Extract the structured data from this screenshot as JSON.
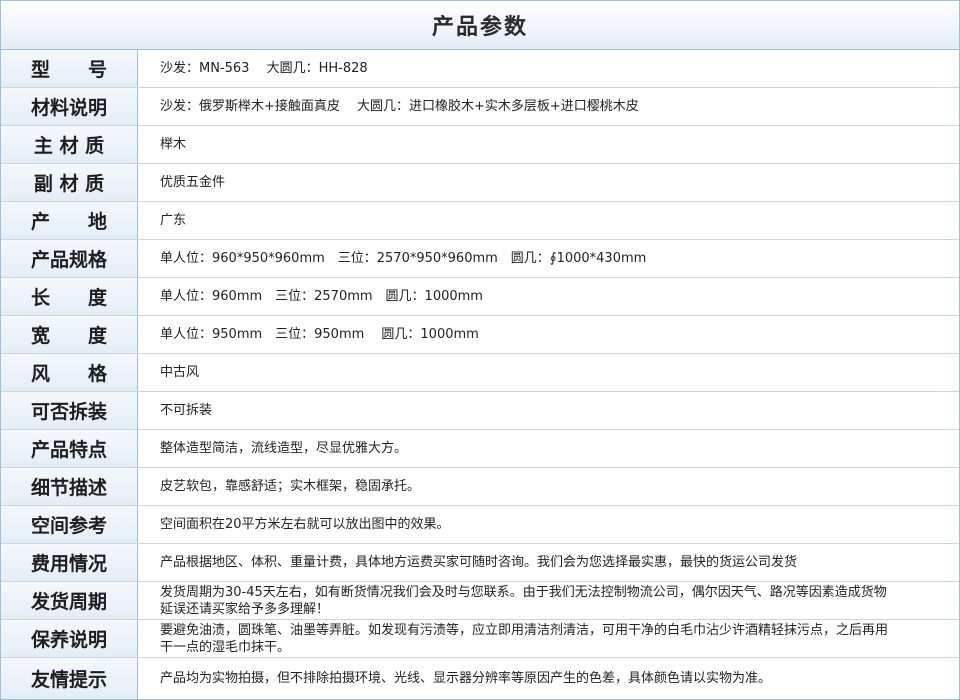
{
  "title": "产品参数",
  "rows": [
    {
      "label": "型　　号",
      "value": "沙发：MN-563　 大圆几：HH-828"
    },
    {
      "label": "材料说明",
      "value": "沙发：俄罗斯榉木+接触面真皮　 大圆几：进口橡胶木+实木多层板+进口樱桃木皮"
    },
    {
      "label": "主 材 质",
      "value": "榉木"
    },
    {
      "label": "副 材 质",
      "value": "优质五金件"
    },
    {
      "label": "产　　地",
      "value": "广东"
    },
    {
      "label": "产品规格",
      "value": "单人位：960*950*960mm　三位：2570*950*960mm　圆几：∮1000*430mm"
    },
    {
      "label": "长　　度",
      "value": "单人位：960mm　三位：2570mm　圆几：1000mm"
    },
    {
      "label": "宽　　度",
      "value": "单人位：950mm　三位：950mm　 圆几：1000mm"
    },
    {
      "label": "风　　格",
      "value": "中古风"
    },
    {
      "label": "可否拆装",
      "value": "不可拆装"
    },
    {
      "label": "产品特点",
      "value": "整体造型简洁，流线造型，尽显优雅大方。"
    },
    {
      "label": "细节描述",
      "value": "皮艺软包，靠感舒适；实木框架，稳固承托。"
    },
    {
      "label": "空间参考",
      "value": "空间面积在20平方米左右就可以放出图中的效果。"
    },
    {
      "label": "费用情况",
      "value": "产品根据地区、体积、重量计费，具体地方运费买家可随时咨询。我们会为您选择最实惠，最快的货运公司发货"
    },
    {
      "label": "发货周期",
      "value": "发货周期为30-45天左右，如有断货情况我们会及时与您联系。由于我们无法控制物流公司，偶尔因天气、路况等因素造成货物延误还请买家给予多多理解！"
    },
    {
      "label": "保养说明",
      "value": "要避免油渍，圆珠笔、油墨等弄脏。如发现有污渍等，应立即用清洁剂清洁，可用干净的白毛巾沾少许酒精轻抹污点，之后再用干一点的湿毛巾抹干。"
    },
    {
      "label": "友情提示",
      "value": "产品均为实物拍摄，但不排除拍摄环境、光线、显示器分辨率等原因产生的色差，具体颜色请以实物为准。"
    }
  ]
}
